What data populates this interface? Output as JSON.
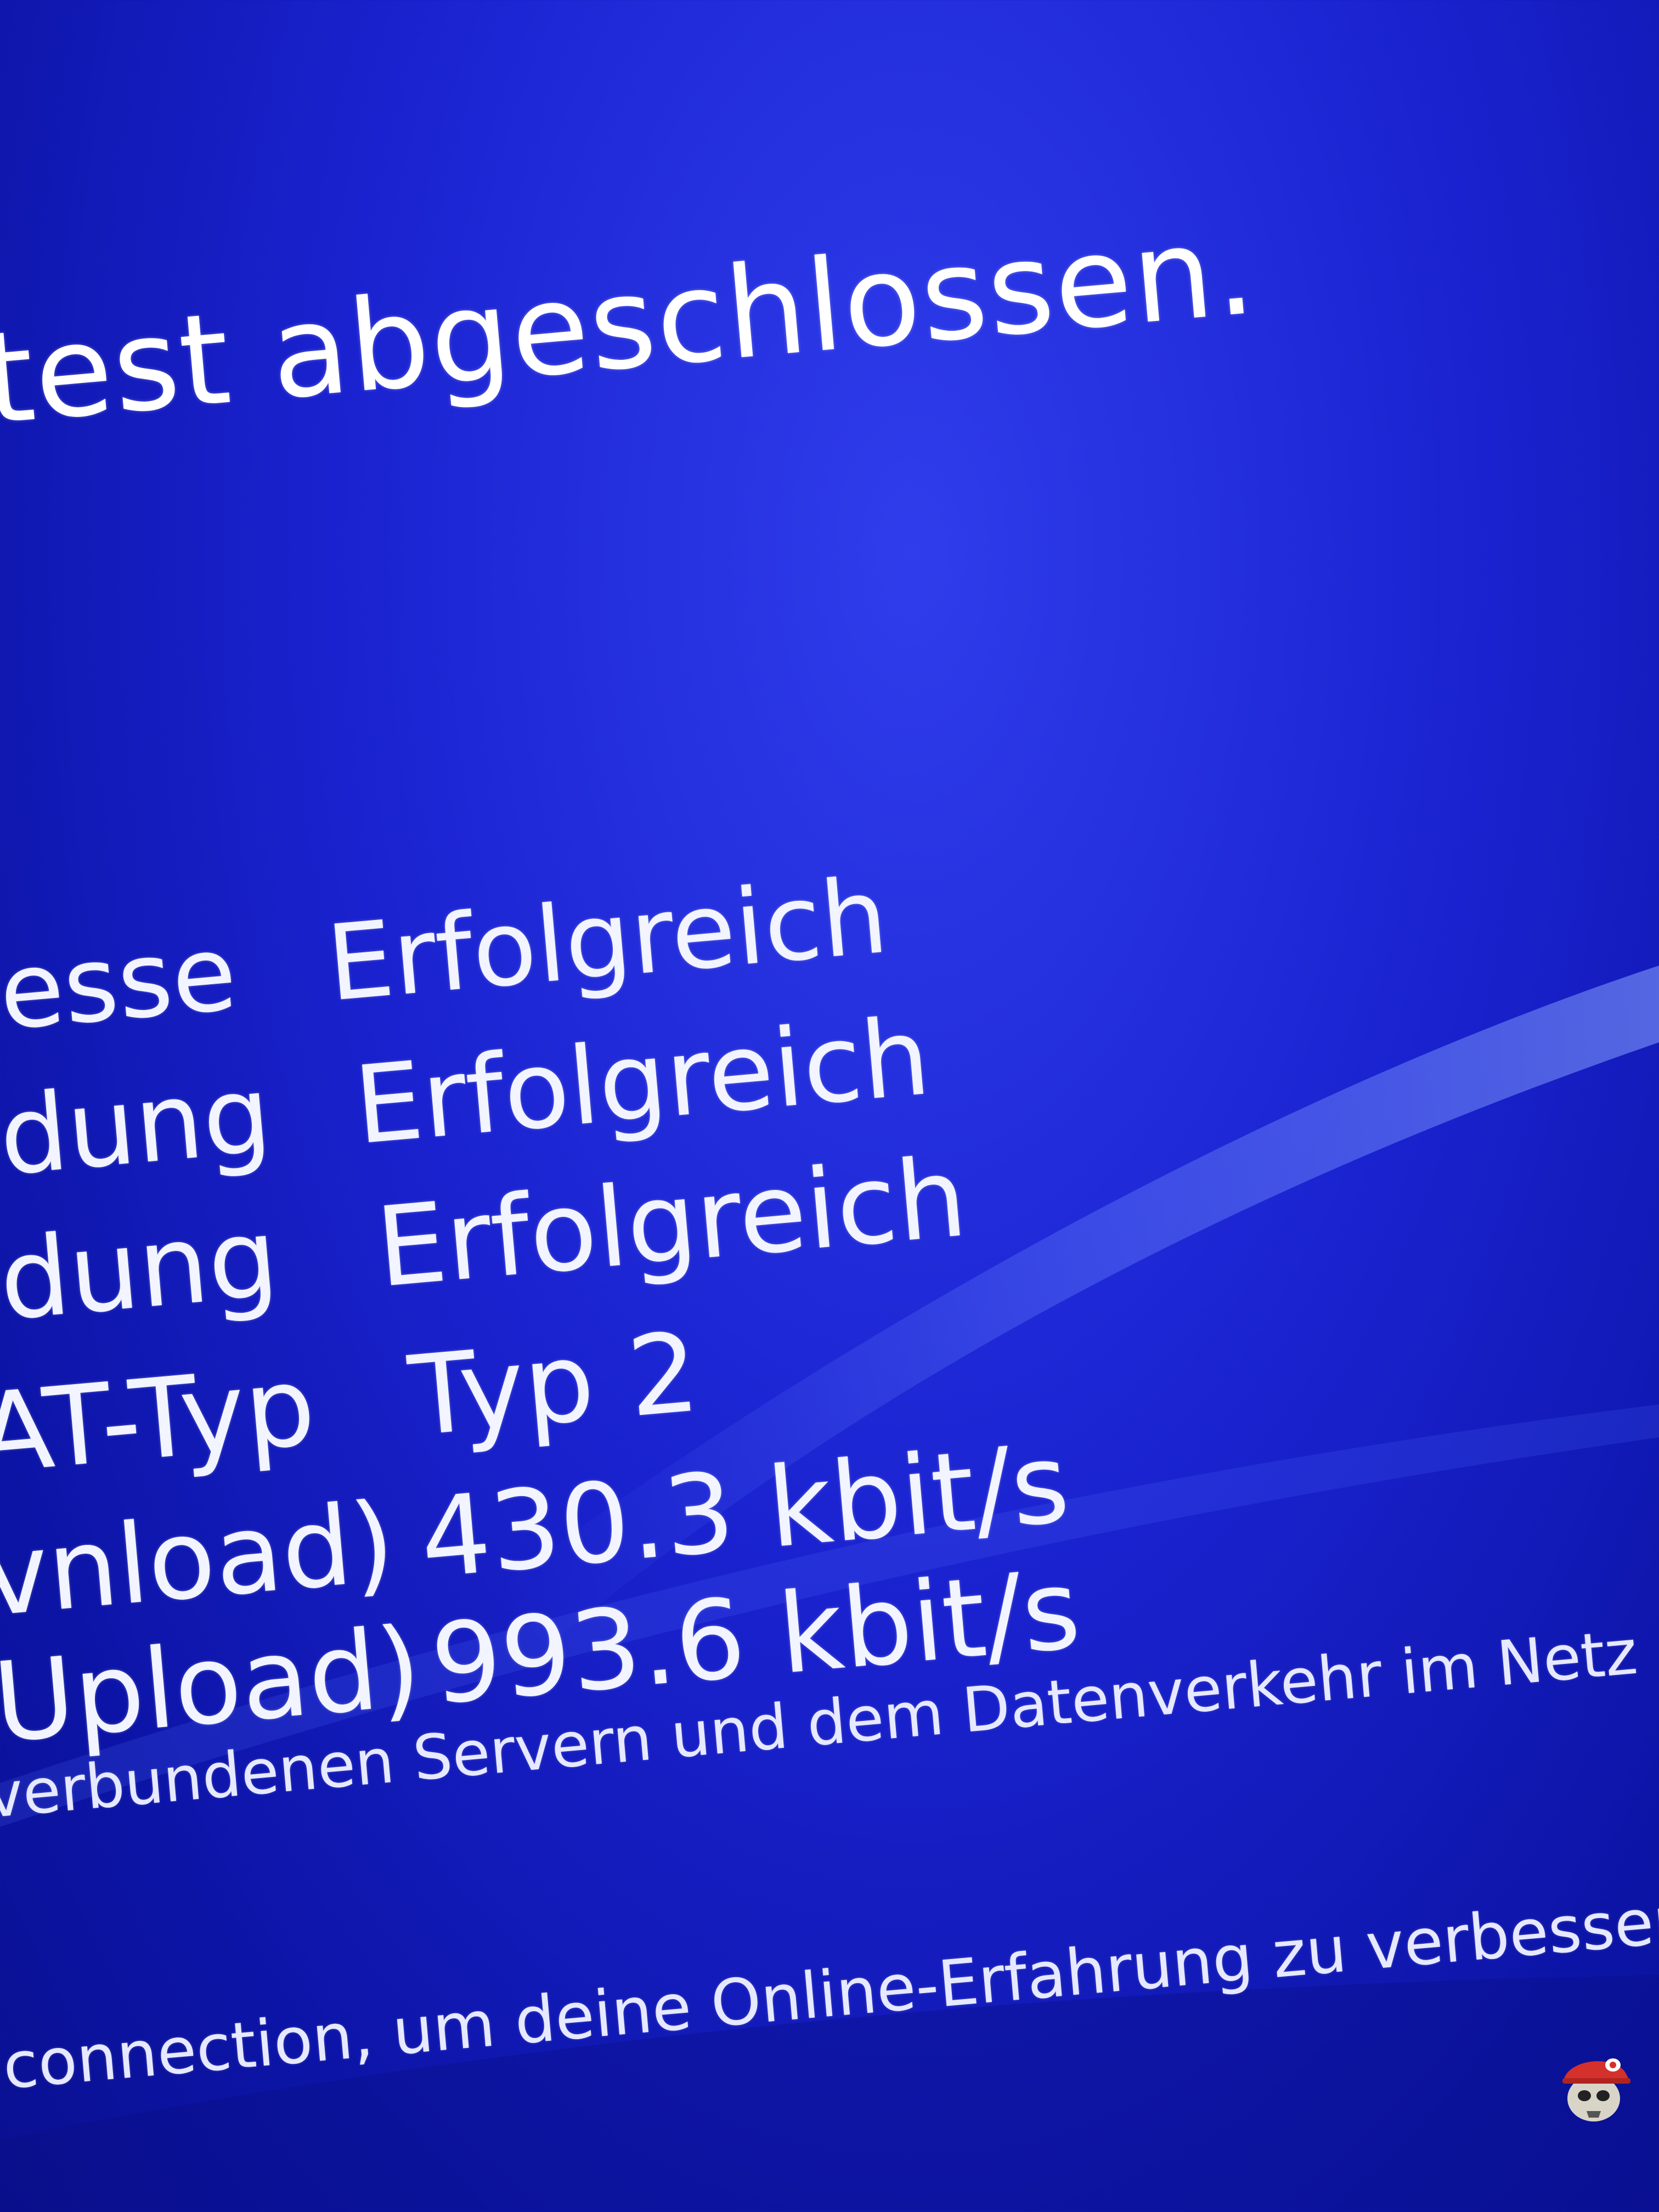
{
  "header": {
    "title": "test abgeschlossen."
  },
  "results": [
    {
      "label": "esse",
      "value": "Erfolgreich"
    },
    {
      "label": "dung",
      "value": "Erfolgreich"
    },
    {
      "label": "dung",
      "value": "Erfolgreich"
    },
    {
      "label": "AT-Typ",
      "value": "Typ 2"
    },
    {
      "label": "vnload)",
      "value": "430.3 kbit/s"
    },
    {
      "label": "Upload)",
      "value": "993.6 kbit/s"
    }
  ],
  "footer": {
    "line1": "verbundenen Servern und dem Datenverkehr im Netz",
    "line2": "connection, um deine Online-Erfahrung zu verbessern."
  },
  "colors": {
    "background": "#1a22cf",
    "text": "#ffffff"
  },
  "icons": {
    "avatar": "user-avatar-icon"
  }
}
